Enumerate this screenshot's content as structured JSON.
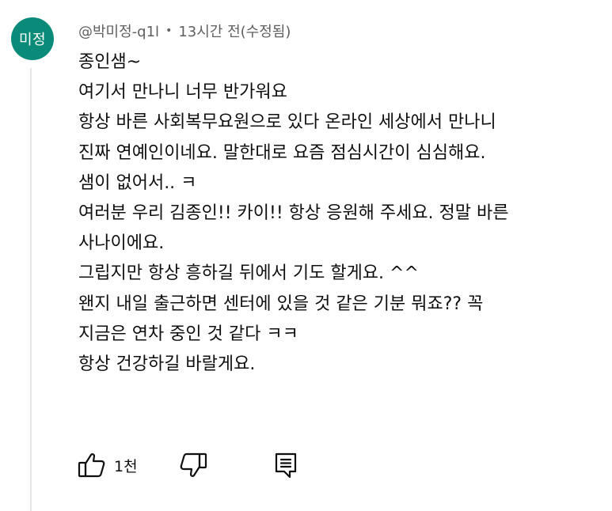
{
  "author": {
    "avatar_text": "미정",
    "handle": "@박미정-q1l",
    "separator": "•",
    "timestamp": "13시간 전(수정됨)"
  },
  "comment": {
    "lines": [
      "종인샘~",
      "여기서 만나니 너무 반가워요",
      "항상 바른 사회복무요원으로 있다 온라인 세상에서 만나니",
      "진짜 연예인이네요. 말한대로 요즘 점심시간이 심심해요.",
      "샘이 없어서.. ㅋ",
      "여러분 우리 김종인!! 카이!! 항상 응원해 주세요. 정말 바른",
      "사나이에요.",
      "그립지만 항상 흥하길 뒤에서 기도 할게요. ^^",
      "왠지 내일 출근하면 센터에 있을 것 같은 기분 뭐죠?? 꼭",
      "지금은 연차 중인 것 같다 ㅋㅋ",
      "항상 건강하길 바랄게요."
    ]
  },
  "actions": {
    "like_count": "1천",
    "like_icon": "thumbs-up-icon",
    "dislike_icon": "thumbs-down-icon",
    "reply_icon": "reply-comment-icon"
  },
  "colors": {
    "avatar_bg": "#0a8b7a",
    "meta_text": "#5f5f5f",
    "body_text": "#0f0f0f"
  }
}
